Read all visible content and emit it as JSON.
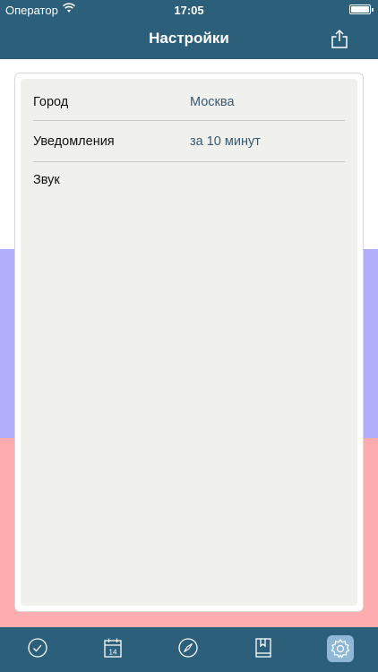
{
  "status": {
    "carrier": "Оператор",
    "time": "17:05"
  },
  "header": {
    "title": "Настройки",
    "share_icon": "share-icon"
  },
  "settings": {
    "rows": [
      {
        "label": "Город",
        "value": "Москва"
      },
      {
        "label": "Уведомления",
        "value": "за 10 минут"
      },
      {
        "label": "Звук",
        "value": ""
      }
    ]
  },
  "tabbar": {
    "items": [
      {
        "icon": "clock-icon"
      },
      {
        "icon": "calendar-icon",
        "badge": "14"
      },
      {
        "icon": "compass-icon"
      },
      {
        "icon": "book-icon"
      },
      {
        "icon": "gear-icon",
        "active": true
      }
    ]
  },
  "colors": {
    "primary": "#2c5f79",
    "accent": "#375a74",
    "flag_blue": "#b2aefc",
    "flag_red": "#fdacaf"
  }
}
